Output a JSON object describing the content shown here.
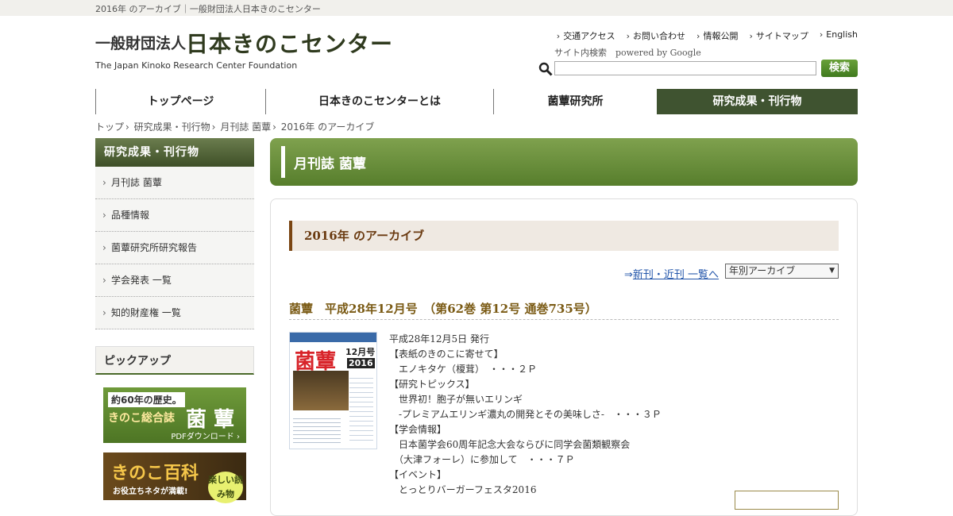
{
  "browser_title": "2016年 のアーカイブ｜一般財団法人日本きのこセンター",
  "logo": {
    "jp_prefix": "一般財団法人",
    "jp_name": "日本きのこセンター",
    "en_name": "The Japan Kinoko Research Center Foundation"
  },
  "header_nav": [
    "交通アクセス",
    "お問い合わせ",
    "情報公開",
    "サイトマップ",
    "English"
  ],
  "search": {
    "label": "サイト内検索　powered by Google",
    "button": "検索",
    "value": ""
  },
  "global_nav": [
    {
      "label": "トップページ",
      "active": false
    },
    {
      "label": "日本きのこセンターとは",
      "active": false
    },
    {
      "label": "菌蕈研究所",
      "active": false
    },
    {
      "label": "研究成果・刊行物",
      "active": true
    }
  ],
  "breadcrumb": [
    "トップ",
    "研究成果・刊行物",
    "月刊誌 菌蕈",
    "2016年 のアーカイブ"
  ],
  "sidebar": {
    "title": "研究成果・刊行物",
    "items": [
      "月刊誌 菌蕈",
      "品種情報",
      "菌蕈研究所研究報告",
      "学会発表 一覧",
      "知的財産権 一覧"
    ]
  },
  "pickup": {
    "title": "ピックアップ",
    "banner1": {
      "line1": "約60年の歴史。",
      "line2": "きのこ総合誌",
      "name": "菌 蕈",
      "cta": "PDFダウンロード ›"
    },
    "banner2": {
      "title": "きのこ百科",
      "sub": "お役立ちネタが満載!",
      "badge": "楽しい読み物"
    }
  },
  "main": {
    "section_title": "月刊誌 菌蕈",
    "year_heading": "2016年 のアーカイブ",
    "new_link_prefix": "⇒",
    "new_link": "新刊・近刊 一覧へ",
    "archive_select": "年別アーカイブ",
    "issue": {
      "title": "菌蕈　平成28年12月号　（第62巻 第12号 通巻735号）",
      "cover": {
        "title": "菌蕈",
        "month": "12月号",
        "year": "2016"
      },
      "lines": [
        "平成28年12月5日 発行",
        "【表紙のきのこに寄せて】",
        "　エノキタケ（榎茸）　・・・２Ｐ",
        "【研究トピックス】",
        "　世界初！胞子が無いエリンギ",
        "　-プレミアムエリンギ濃丸の開発とその美味しさ-　・・・３Ｐ",
        "【学会情報】",
        "　日本菌学会60周年記念大会ならびに同学会菌類観察会",
        "　（大津フォーレ）に参加して　・・・７Ｐ",
        "【イベント】",
        "　とっとりバーガーフェスタ2016"
      ]
    }
  },
  "colors": {
    "accent_green": "#577e2c",
    "nav_active": "#3f5330",
    "heading_brown": "#6a3a10",
    "link_blue": "#2255aa"
  }
}
